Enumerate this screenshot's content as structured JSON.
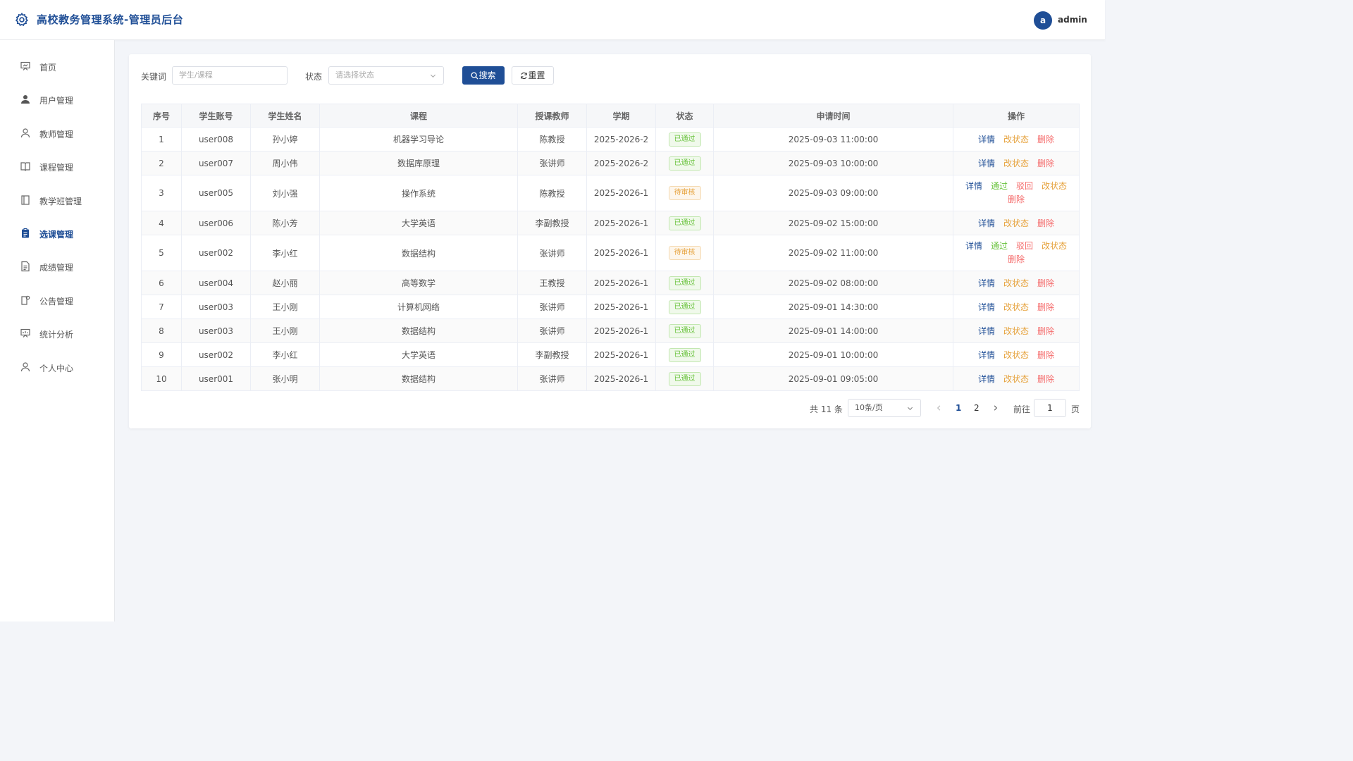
{
  "header": {
    "title": "高校教务管理系统-管理员后台",
    "avatar_letter": "a",
    "username": "admin"
  },
  "sidebar": {
    "items": [
      {
        "label": "首页",
        "icon": "home-board-icon"
      },
      {
        "label": "用户管理",
        "icon": "user-filled-icon"
      },
      {
        "label": "教师管理",
        "icon": "user-icon"
      },
      {
        "label": "课程管理",
        "icon": "book-icon"
      },
      {
        "label": "教学班管理",
        "icon": "notebook-icon"
      },
      {
        "label": "选课管理",
        "icon": "clipboard-icon",
        "active": true
      },
      {
        "label": "成绩管理",
        "icon": "document-icon"
      },
      {
        "label": "公告管理",
        "icon": "notice-icon"
      },
      {
        "label": "统计分析",
        "icon": "chart-icon"
      },
      {
        "label": "个人中心",
        "icon": "user-icon"
      }
    ]
  },
  "filters": {
    "keyword_label": "关键词",
    "keyword_placeholder": "学生/课程",
    "status_label": "状态",
    "status_placeholder": "请选择状态",
    "search_button": "搜索",
    "reset_button": "重置"
  },
  "table": {
    "columns": [
      "序号",
      "学生账号",
      "学生姓名",
      "课程",
      "授课教师",
      "学期",
      "状态",
      "申请时间",
      "操作"
    ],
    "rows": [
      {
        "no": "1",
        "account": "user008",
        "name": "孙小婷",
        "course": "机器学习导论",
        "teacher": "陈教授",
        "term": "2025-2026-2",
        "status": "已通过",
        "time": "2025-09-03 11:00:00"
      },
      {
        "no": "2",
        "account": "user007",
        "name": "周小伟",
        "course": "数据库原理",
        "teacher": "张讲师",
        "term": "2025-2026-2",
        "status": "已通过",
        "time": "2025-09-03 10:00:00"
      },
      {
        "no": "3",
        "account": "user005",
        "name": "刘小强",
        "course": "操作系统",
        "teacher": "陈教授",
        "term": "2025-2026-1",
        "status": "待审核",
        "time": "2025-09-03 09:00:00"
      },
      {
        "no": "4",
        "account": "user006",
        "name": "陈小芳",
        "course": "大学英语",
        "teacher": "李副教授",
        "term": "2025-2026-1",
        "status": "已通过",
        "time": "2025-09-02 15:00:00"
      },
      {
        "no": "5",
        "account": "user002",
        "name": "李小红",
        "course": "数据结构",
        "teacher": "张讲师",
        "term": "2025-2026-1",
        "status": "待审核",
        "time": "2025-09-02 11:00:00"
      },
      {
        "no": "6",
        "account": "user004",
        "name": "赵小丽",
        "course": "高等数学",
        "teacher": "王教授",
        "term": "2025-2026-1",
        "status": "已通过",
        "time": "2025-09-02 08:00:00"
      },
      {
        "no": "7",
        "account": "user003",
        "name": "王小刚",
        "course": "计算机网络",
        "teacher": "张讲师",
        "term": "2025-2026-1",
        "status": "已通过",
        "time": "2025-09-01 14:30:00"
      },
      {
        "no": "8",
        "account": "user003",
        "name": "王小刚",
        "course": "数据结构",
        "teacher": "张讲师",
        "term": "2025-2026-1",
        "status": "已通过",
        "time": "2025-09-01 14:00:00"
      },
      {
        "no": "9",
        "account": "user002",
        "name": "李小红",
        "course": "大学英语",
        "teacher": "李副教授",
        "term": "2025-2026-1",
        "status": "已通过",
        "time": "2025-09-01 10:00:00"
      },
      {
        "no": "10",
        "account": "user001",
        "name": "张小明",
        "course": "数据结构",
        "teacher": "张讲师",
        "term": "2025-2026-1",
        "status": "已通过",
        "time": "2025-09-01 09:05:00"
      }
    ],
    "actions": {
      "detail": "详情",
      "approve": "通过",
      "reject": "驳回",
      "change_status": "改状态",
      "delete": "删除"
    }
  },
  "pagination": {
    "total": "共 11 条",
    "page_size": "10条/页",
    "pages": [
      "1",
      "2"
    ],
    "current_page": "1",
    "goto_label": "前往",
    "goto_value": "1",
    "page_suffix": "页"
  },
  "colors": {
    "primary": "#1f4e96",
    "success": "#67c23a",
    "warning": "#e6a23c",
    "danger": "#f56c6c",
    "background": "#f3f5f9"
  }
}
